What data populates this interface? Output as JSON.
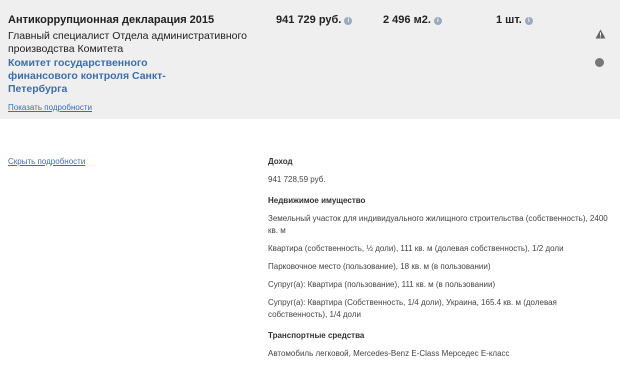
{
  "header": {
    "title": "Антикоррупционная декларация 2015",
    "position": "Главный специалист Отдела административного производства Комитета",
    "organization": "Комитет государственного финансового контроля Санкт-Петербурга",
    "show_details": "Показать подробности"
  },
  "summary": {
    "income": "941 729 руб.",
    "area": "2 496 м2.",
    "vehicles": "1 шт."
  },
  "icons": {
    "info": "info-icon",
    "warning": "warning-icon",
    "status": "circle-icon"
  },
  "details": {
    "hide_details": "Скрыть подробности",
    "income_heading": "Доход",
    "income_value": "941 728,59 руб.",
    "realty_heading": "Недвижимое имущество",
    "realty": [
      "Земельный участок для индивидуального жилищного строительства (собственность), 2400 кв. м",
      "Квартира (собственность, ½ доли), 111 кв. м (долевая собственность), 1/2 доли",
      "Парковочное место (пользование), 18 кв. м (в пользовании)",
      "Супруг(а): Квартира (пользование), 111 кв. м (в пользовании)",
      "Супруг(а): Квартира (Собственность, 1/4 доли), Украина, 165.4 кв. м (долевая собственность), 1/4 доли"
    ],
    "transport_heading": "Транспортные средства",
    "transport_value": "Автомобиль легковой, Mercedes-Benz E-Class Мерседес E-класс"
  }
}
